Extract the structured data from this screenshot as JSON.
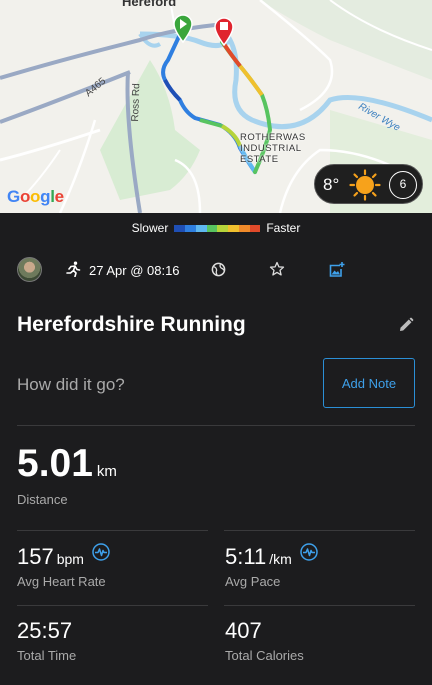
{
  "map": {
    "labels": {
      "hereford": "Hereford",
      "a465": "A465",
      "ross_rd": "Ross Rd",
      "river_wye": "River Wye",
      "estate": "ROTHERWAS INDUSTRIAL ESTATE"
    },
    "google_letters": [
      "G",
      "o",
      "o",
      "g",
      "l",
      "e"
    ],
    "weather": {
      "temperature": "8°",
      "moon_phase": "6"
    }
  },
  "legend": {
    "slower": "Slower",
    "faster": "Faster",
    "colors": [
      "#1f4fb5",
      "#2f7fe0",
      "#5fb8f0",
      "#58c460",
      "#b6d43a",
      "#f0c02e",
      "#f08a2a",
      "#e04a2a"
    ]
  },
  "activity": {
    "date": "27 Apr @ 08:16",
    "title": "Herefordshire Running",
    "note_prompt": "How did it go?",
    "add_note_label": "Add Note"
  },
  "stats": {
    "distance": {
      "value": "5.01",
      "unit": "km",
      "label": "Distance"
    },
    "heart_rate": {
      "value": "157",
      "unit": "bpm",
      "label": "Avg Heart Rate"
    },
    "pace": {
      "value": "5:11",
      "unit": "/km",
      "label": "Avg Pace"
    },
    "time": {
      "value": "25:57",
      "label": "Total Time"
    },
    "calories": {
      "value": "407",
      "label": "Total Calories"
    }
  },
  "colors": {
    "accent": "#2b8fd6",
    "background": "#1c1c1e"
  }
}
